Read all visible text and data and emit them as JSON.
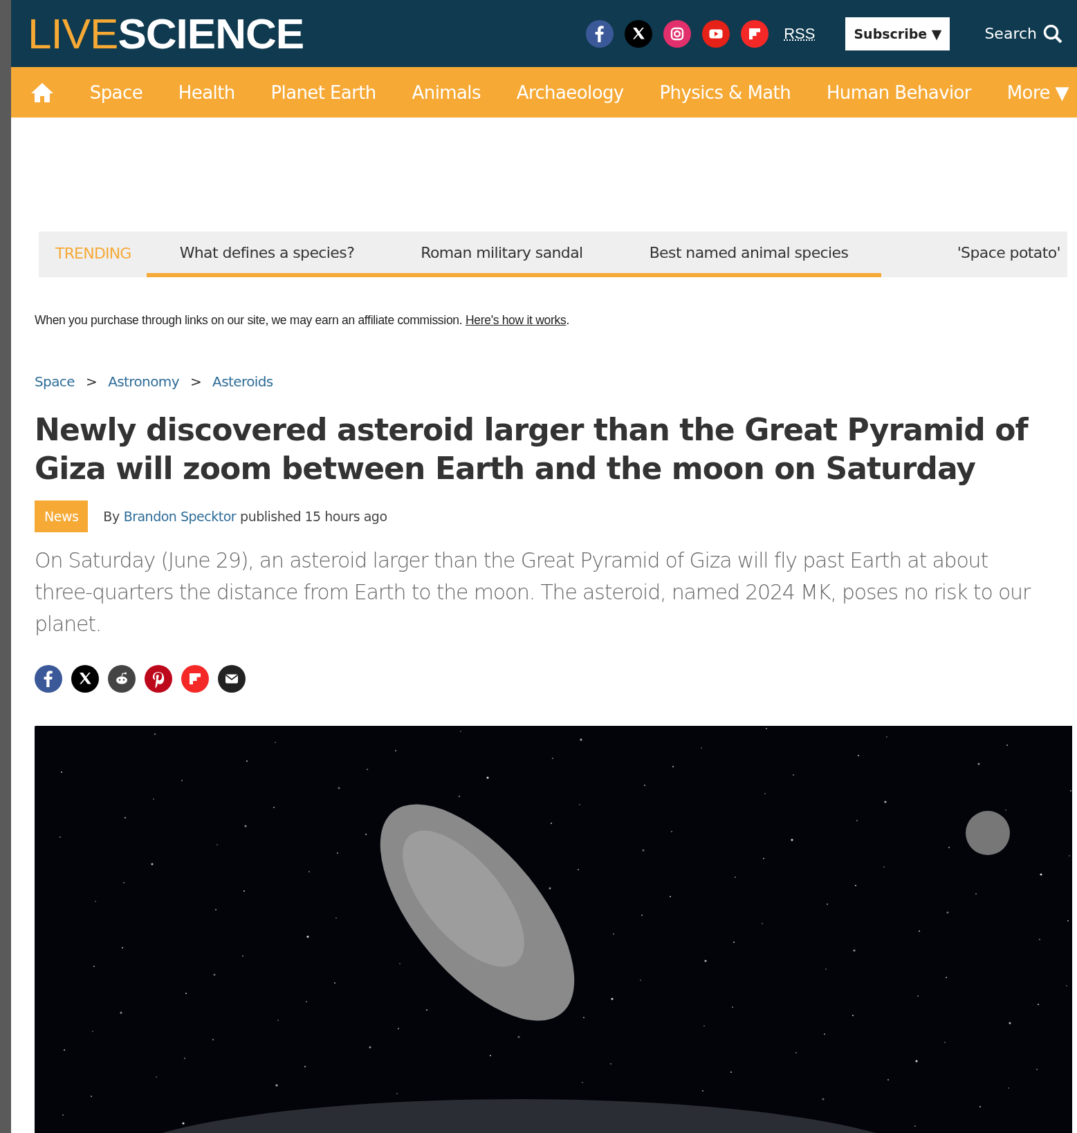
{
  "header": {
    "logo": {
      "light": "LIVE",
      "bold": "SCIENCE"
    },
    "social": [
      {
        "kind": "facebook"
      },
      {
        "kind": "x"
      },
      {
        "kind": "instagram"
      },
      {
        "kind": "youtube"
      },
      {
        "kind": "flipboard"
      }
    ],
    "rss": "RSS",
    "subscribe": "Subscribe ▼",
    "search": "Search"
  },
  "nav": {
    "items": [
      "Space",
      "Health",
      "Planet Earth",
      "Animals",
      "Archaeology",
      "Physics & Math",
      "Human Behavior"
    ],
    "more": "More ▼"
  },
  "trending": {
    "label": "TRENDING",
    "items": [
      {
        "text": "What defines a species?",
        "underlined": true
      },
      {
        "text": "Roman military sandal",
        "underlined": true
      },
      {
        "text": "Best named animal species",
        "underlined": true
      },
      {
        "text": "'Space potato'",
        "underlined": false
      }
    ]
  },
  "affiliate": {
    "text": "When you purchase through links on our site, we may earn an affiliate commission.",
    "link": "Here's how it works",
    "end": "."
  },
  "breadcrumb": [
    "Space",
    "Astronomy",
    "Asteroids"
  ],
  "breadcrumb_separator": ">",
  "article": {
    "title": "Newly discovered asteroid larger than the Great Pyramid of Giza will zoom between Earth and the moon on Saturday",
    "badge": "News",
    "by": "By",
    "author": "Brandon Specktor",
    "published": "published 15 hours ago",
    "summary": "On Saturday (June 29), an asteroid larger than the Great Pyramid of Giza will fly past Earth at about three-quarters the distance from Earth to the moon. The asteroid, named 2024 MK, poses no risk to our planet.",
    "share": [
      {
        "kind": "facebook"
      },
      {
        "kind": "x"
      },
      {
        "kind": "reddit"
      },
      {
        "kind": "pinterest"
      },
      {
        "kind": "flipboard"
      },
      {
        "kind": "email"
      }
    ]
  }
}
